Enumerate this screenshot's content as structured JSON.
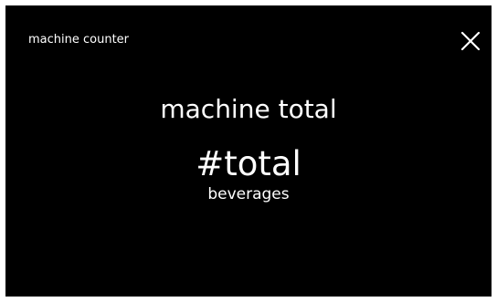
{
  "header": {
    "title": "machine counter",
    "close_icon": "close-icon"
  },
  "counter": {
    "heading": "machine total",
    "value": "#total",
    "unit": "beverages"
  },
  "colors": {
    "background": "#000000",
    "text": "#ffffff",
    "frame": "#ffffff"
  }
}
